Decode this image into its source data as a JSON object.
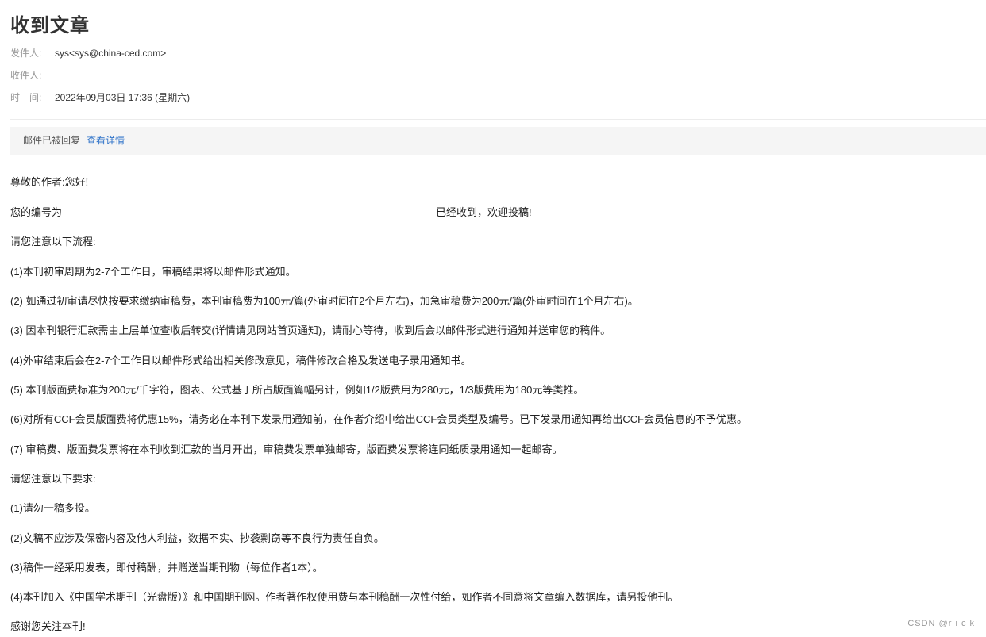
{
  "email": {
    "subject": "收到文章",
    "from_label": "发件人:",
    "from_value": "sys<sys@china-ced.com>",
    "to_label": "收件人:",
    "to_value": "",
    "time_label": "时　间:",
    "time_value": "2022年09月03日 17:36 (星期六)"
  },
  "notice": {
    "text": "邮件已被回复",
    "link": "查看详情"
  },
  "body": {
    "greeting": "尊敬的作者:您好!",
    "number_prefix": "您的编号为",
    "number_suffix": "已经收到，欢迎投稿!",
    "process_title": "请您注意以下流程:",
    "process": [
      "(1)本刊初审周期为2-7个工作日，审稿结果将以邮件形式通知。",
      "(2) 如通过初审请尽快按要求缴纳审稿费，本刊审稿费为100元/篇(外审时间在2个月左右)，加急审稿费为200元/篇(外审时间在1个月左右)。",
      "(3) 因本刊银行汇款需由上层单位查收后转交(详情请见网站首页通知)，请耐心等待，收到后会以邮件形式进行通知并送审您的稿件。",
      "(4)外审结束后会在2-7个工作日以邮件形式给出相关修改意见，稿件修改合格及发送电子录用通知书。",
      "(5) 本刊版面费标准为200元/千字符，图表、公式基于所占版面篇幅另计，例如1/2版费用为280元，1/3版费用为180元等类推。",
      "(6)对所有CCF会员版面费将优惠15%，请务必在本刊下发录用通知前，在作者介绍中给出CCF会员类型及编号。已下发录用通知再给出CCF会员信息的不予优惠。",
      "(7) 审稿费、版面费发票将在本刊收到汇款的当月开出，审稿费发票单独邮寄，版面费发票将连同纸质录用通知一起邮寄。"
    ],
    "requirements_title": "请您注意以下要求:",
    "requirements": [
      "(1)请勿一稿多投。",
      "(2)文稿不应涉及保密内容及他人利益，数据不实、抄袭剽窃等不良行为责任自负。",
      "(3)稿件一经采用发表，即付稿酬，并赠送当期刊物（每位作者1本）。",
      "(4)本刊加入《中国学术期刊（光盘版）》和中国期刊网。作者著作权使用费与本刊稿酬一次性付给，如作者不同意将文章编入数据库，请另投他刊。"
    ],
    "closing": "感谢您关注本刊!"
  },
  "watermark": "CSDN @r i c k"
}
